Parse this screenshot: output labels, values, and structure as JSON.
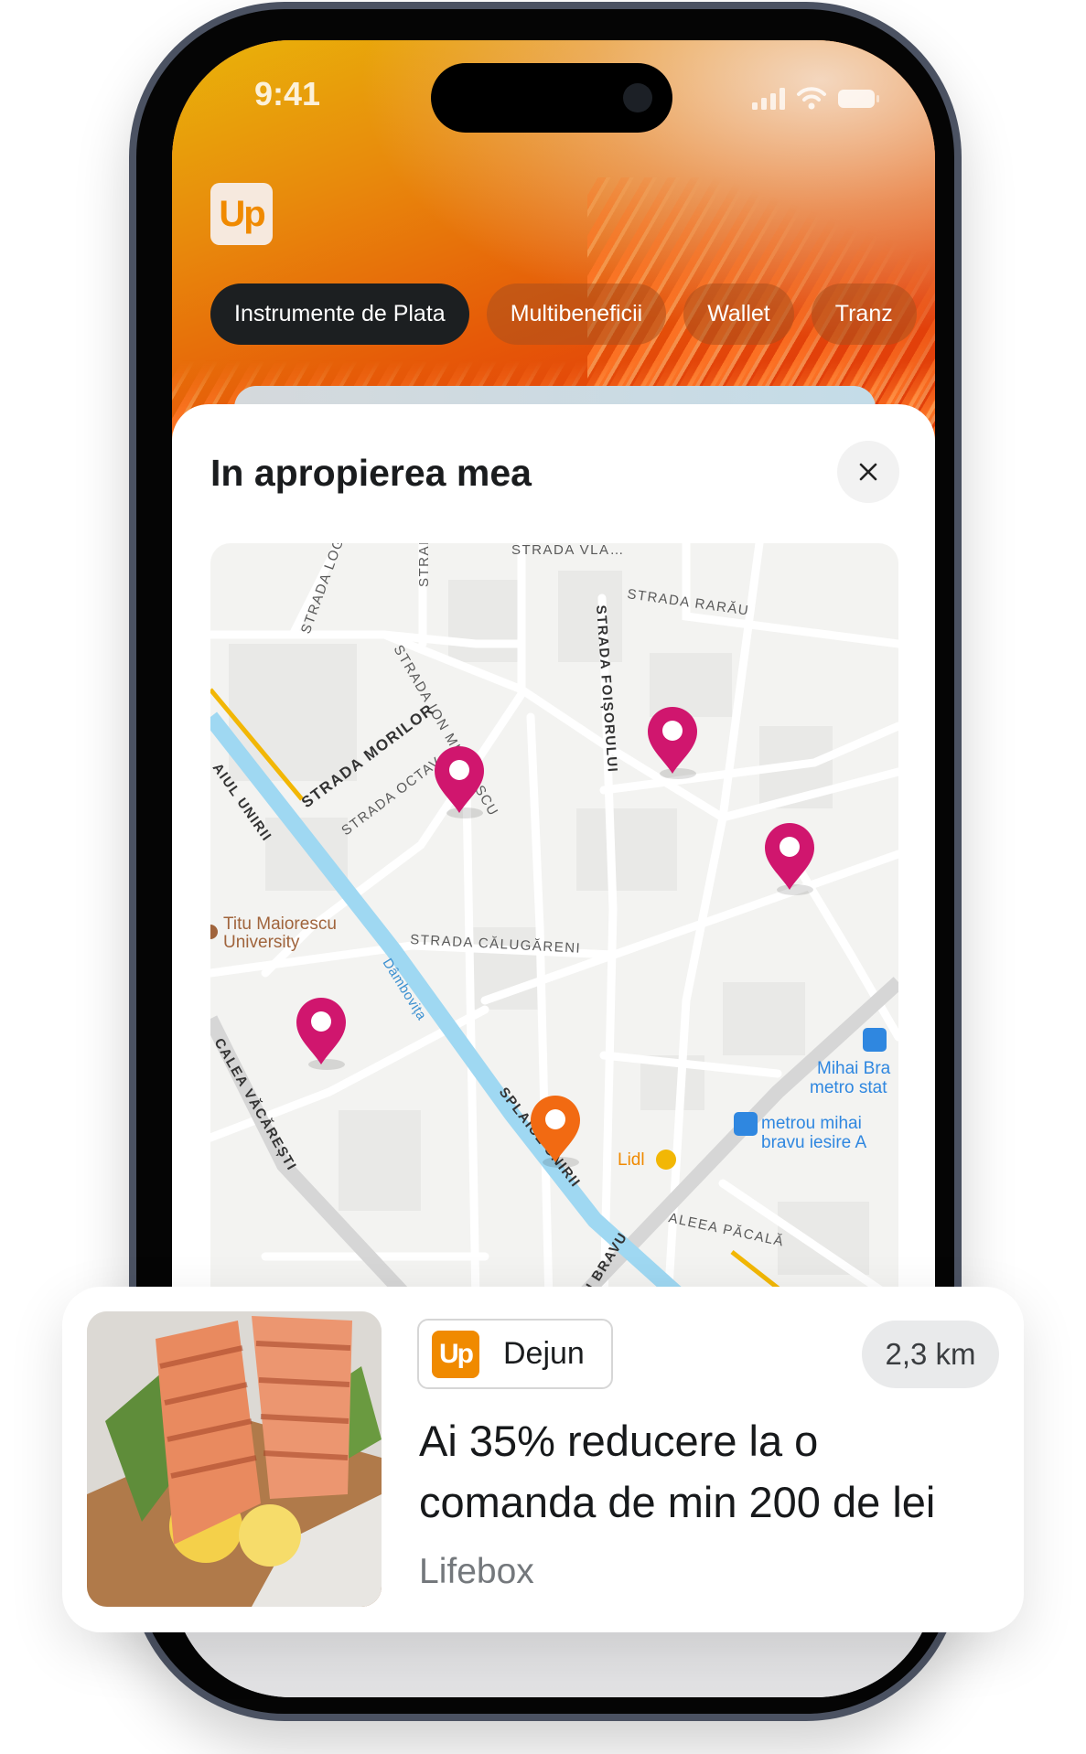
{
  "status_bar": {
    "time": "9:41",
    "icons": [
      "signal-icon",
      "wifi-icon",
      "battery-icon"
    ]
  },
  "app": {
    "logo_text": "Up",
    "brand_color": "#f08a00"
  },
  "tabs": [
    {
      "label": "Instrumente de Plata",
      "active": true
    },
    {
      "label": "Multibeneficii",
      "active": false
    },
    {
      "label": "Wallet",
      "active": false
    },
    {
      "label": "Tranz",
      "active": false
    }
  ],
  "sheet": {
    "title": "In apropierea mea",
    "close_icon": "close-icon"
  },
  "map": {
    "street_labels": [
      "STRADA VLA…",
      "STRADA LOG",
      "STRAI",
      "STRADA RARĂU",
      "STRADA FOIȘORULUI",
      "STRADA ION MINULESCU",
      "STRADA MORILOR",
      "STRADA OCTAV",
      "AIUL UNIRII",
      "STRADA CĂLUGĂRENI",
      "CALEA VĂCĂREȘTI",
      "SPLAIUL UNIRII",
      "ALEEA PĂCALĂ",
      "AI BRAVU"
    ],
    "river_label": "Dâmbovița",
    "poi": {
      "university": "Titu Maiorescu",
      "university2": "University",
      "lidl": "Lidl",
      "metro1a": "Mihai Bra",
      "metro1b": "metro stat",
      "metro2a": "metrou mihai",
      "metro2b": "bravu iesire A"
    },
    "pin_colors": {
      "default": "#d0166e",
      "selected": "#f26a12"
    }
  },
  "offer": {
    "badge_logo": "Up",
    "badge_label": "Dejun",
    "distance": "2,3 km",
    "headline_line1": "Ai 35% reducere la o",
    "headline_line2": "comanda de min 200 de lei",
    "merchant": "Lifebox"
  }
}
